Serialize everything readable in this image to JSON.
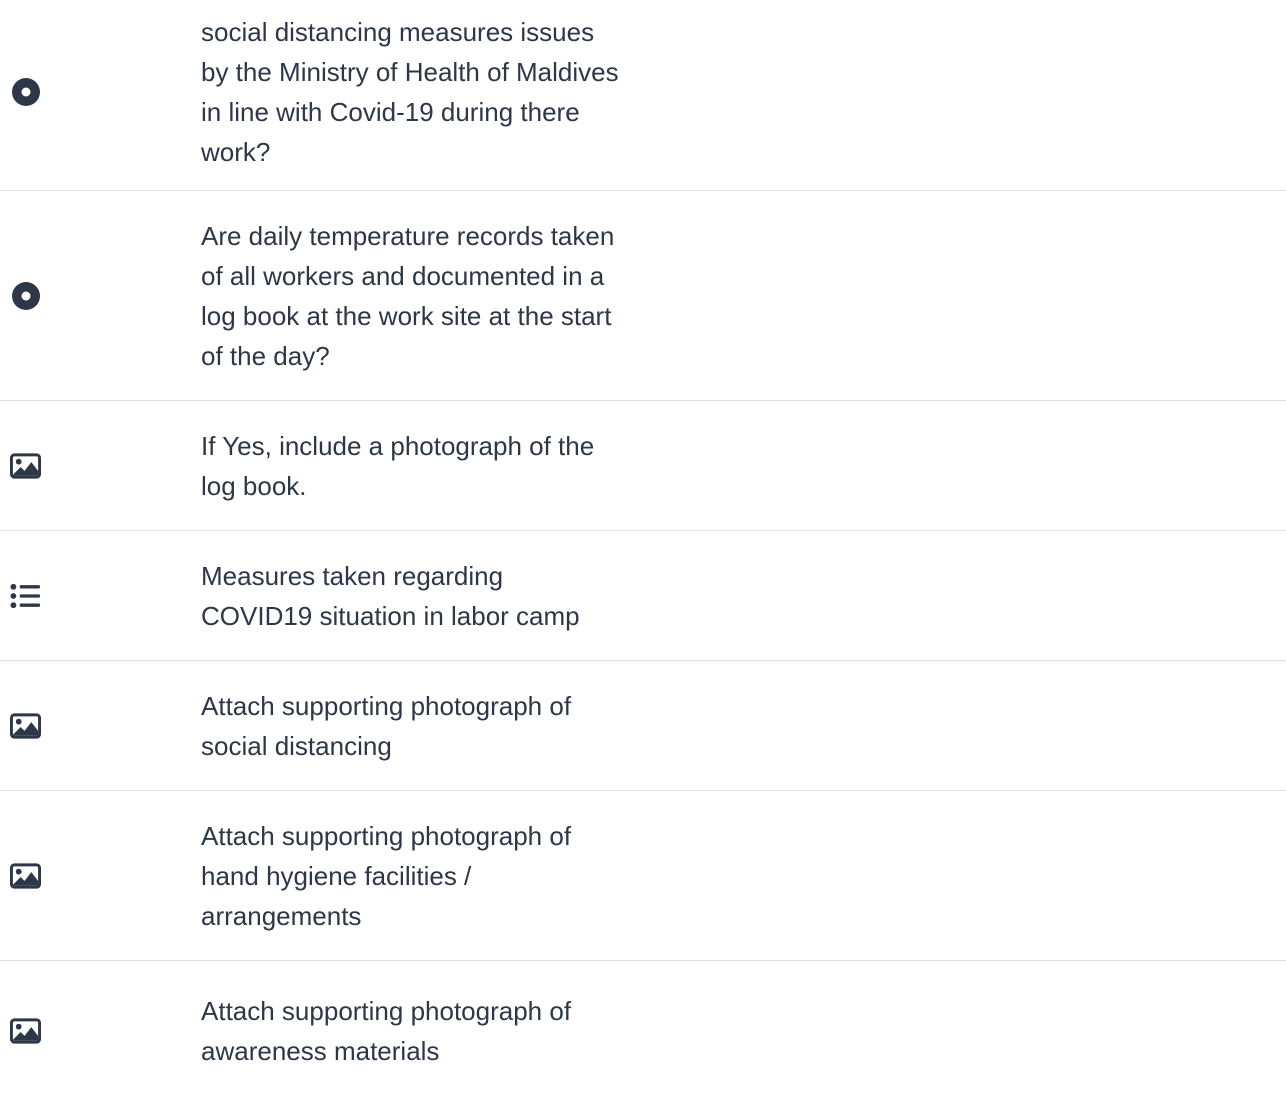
{
  "questions": [
    {
      "icon": "radio-icon",
      "label": "social distancing measures issues by the Ministry of Health of Maldives in line with Covid-19 during there work?"
    },
    {
      "icon": "radio-icon",
      "label": "Are daily temperature records taken of all workers and documented in a log book at the work site at the start of the day?"
    },
    {
      "icon": "image-icon",
      "label": "If Yes, include a photograph of the log book."
    },
    {
      "icon": "list-icon",
      "label": "Measures taken regarding COVID19 situation in labor camp"
    },
    {
      "icon": "image-icon",
      "label": "Attach supporting photograph of social distancing"
    },
    {
      "icon": "image-icon",
      "label": "Attach supporting photograph of hand hygiene facilities / arrangements"
    },
    {
      "icon": "image-icon",
      "label": "Attach supporting photograph of awareness materials"
    }
  ],
  "colors": {
    "icon": "#2d3748",
    "text": "#2d3748",
    "divider": "#dde1e6"
  }
}
